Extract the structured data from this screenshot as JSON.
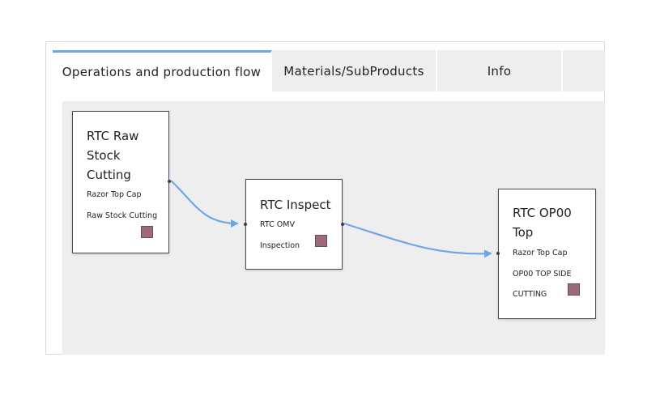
{
  "tabs": [
    {
      "label": "Operations and production flow",
      "active": true
    },
    {
      "label": "Materials/SubProducts",
      "active": false
    },
    {
      "label": "Info",
      "active": false
    },
    {
      "label": "",
      "active": false
    }
  ],
  "nodes": [
    {
      "title_lines": [
        "RTC Raw",
        "Stock",
        "Cutting"
      ],
      "line1": "Razor Top Cap",
      "line2": "Raw Stock Cutting"
    },
    {
      "title_lines": [
        "RTC Inspect"
      ],
      "line1": "RTC OMV",
      "line2": "Inspection"
    },
    {
      "title_lines": [
        "RTC OP00",
        "Top"
      ],
      "line1": "Razor Top Cap",
      "line2": "OP00 TOP SIDE",
      "line3": "CUTTING"
    }
  ],
  "colors": {
    "edge": "#6ea7e6",
    "swatch": "#9c6a78",
    "active_tab_accent": "#6ea7e6"
  }
}
